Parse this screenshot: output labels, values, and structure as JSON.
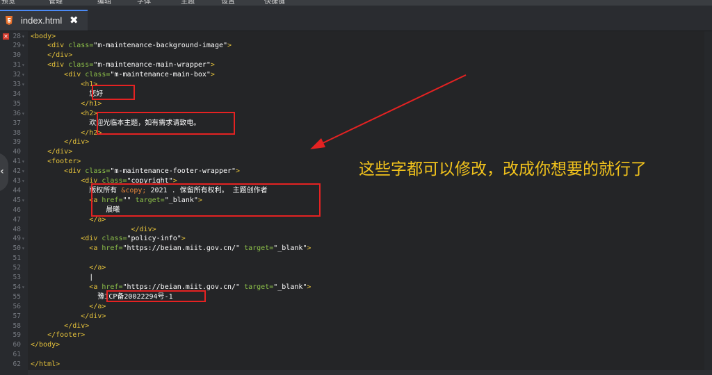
{
  "menu": [
    "预览",
    "管理",
    "编辑",
    "字体",
    "主题",
    "设置",
    "快捷键"
  ],
  "tab": {
    "filename": "index.html",
    "close_label": "✖"
  },
  "lines": [
    {
      "n": "28",
      "html": "<span class=\"tag\">&lt;body&gt;</span>"
    },
    {
      "n": "29",
      "html": "    <span class=\"tag\">&lt;div</span> <span class=\"attr\">class=</span><span class=\"str\">\"m-maintenance-background-image\"</span><span class=\"tag\">&gt;</span>"
    },
    {
      "n": "30",
      "html": "    <span class=\"tag\">&lt;/div&gt;</span>"
    },
    {
      "n": "31",
      "html": "    <span class=\"tag\">&lt;div</span> <span class=\"attr\">class=</span><span class=\"str\">\"m-maintenance-main-wrapper\"</span><span class=\"tag\">&gt;</span>"
    },
    {
      "n": "32",
      "html": "        <span class=\"tag\">&lt;div</span> <span class=\"attr\">class=</span><span class=\"str\">\"m-maintenance-main-box\"</span><span class=\"tag\">&gt;</span>"
    },
    {
      "n": "33",
      "html": "            <span class=\"tag\">&lt;h1&gt;</span>"
    },
    {
      "n": "34",
      "html": "              <span class=\"txt\">您好</span>"
    },
    {
      "n": "35",
      "html": "            <span class=\"tag\">&lt;/h1&gt;</span>"
    },
    {
      "n": "36",
      "html": "            <span class=\"tag\">&lt;h2&gt;</span>"
    },
    {
      "n": "37",
      "html": "              <span class=\"txt\">欢迎光临本主题，如有需求请致电。</span>"
    },
    {
      "n": "38",
      "html": "            <span class=\"tag\">&lt;/h2&gt;</span>"
    },
    {
      "n": "39",
      "html": "        <span class=\"tag\">&lt;/div&gt;</span>"
    },
    {
      "n": "40",
      "html": "    <span class=\"tag\">&lt;/div&gt;</span>"
    },
    {
      "n": "41",
      "html": "    <span class=\"tag\">&lt;footer&gt;</span>"
    },
    {
      "n": "42",
      "html": "        <span class=\"tag\">&lt;div</span> <span class=\"attr\">class=</span><span class=\"str\">\"m-maintenance-footer-wrapper\"</span><span class=\"tag\">&gt;</span>"
    },
    {
      "n": "43",
      "html": "            <span class=\"tag\">&lt;div</span> <span class=\"attr\">class=</span><span class=\"str\">\"copyright\"</span><span class=\"tag\">&gt;</span>"
    },
    {
      "n": "44",
      "html": "              <span class=\"txt\">版权所有 </span><span class=\"ent\">&amp;copy;</span><span class=\"txt\"> 2021 . 保留所有权利。 主题创作者</span>"
    },
    {
      "n": "45",
      "html": "              <span class=\"tag\">&lt;a</span> <span class=\"attr\">href=</span><span class=\"str\">\"\"</span> <span class=\"attr\">target=</span><span class=\"str\">\"_blank\"</span><span class=\"tag\">&gt;</span>"
    },
    {
      "n": "46",
      "html": "                  <span class=\"txt\">晨曦</span>"
    },
    {
      "n": "47",
      "html": "              <span class=\"tag\">&lt;/a&gt;</span>"
    },
    {
      "n": "48",
      "html": "                        <span class=\"tag\">&lt;/div&gt;</span>"
    },
    {
      "n": "49",
      "html": "            <span class=\"tag\">&lt;div</span> <span class=\"attr\">class=</span><span class=\"str\">\"policy-info\"</span><span class=\"tag\">&gt;</span>"
    },
    {
      "n": "50",
      "html": "              <span class=\"tag\">&lt;a</span> <span class=\"attr\">href=</span><span class=\"str\">\"https://beian.miit.gov.cn/\"</span> <span class=\"attr\">target=</span><span class=\"str\">\"_blank\"</span><span class=\"tag\">&gt;</span>"
    },
    {
      "n": "51",
      "html": ""
    },
    {
      "n": "52",
      "html": "              <span class=\"tag\">&lt;/a&gt;</span>"
    },
    {
      "n": "53",
      "html": "              <span class=\"txt\">|</span>"
    },
    {
      "n": "54",
      "html": "              <span class=\"tag\">&lt;a</span> <span class=\"attr\">href=</span><span class=\"str\">\"https://beian.miit.gov.cn/\"</span> <span class=\"attr\">target=</span><span class=\"str\">\"_blank\"</span><span class=\"tag\">&gt;</span>"
    },
    {
      "n": "55",
      "html": "                <span class=\"txt\">豫ICP备20022294号-1</span>"
    },
    {
      "n": "56",
      "html": "              <span class=\"tag\">&lt;/a&gt;</span>"
    },
    {
      "n": "57",
      "html": "            <span class=\"tag\">&lt;/div&gt;</span>"
    },
    {
      "n": "58",
      "html": "        <span class=\"tag\">&lt;/div&gt;</span>"
    },
    {
      "n": "59",
      "html": "    <span class=\"tag\">&lt;/footer&gt;</span>"
    },
    {
      "n": "60",
      "html": "<span class=\"tag\">&lt;/body&gt;</span>"
    },
    {
      "n": "61",
      "html": ""
    },
    {
      "n": "62",
      "html": "<span class=\"tag\">&lt;/html&gt;</span>"
    }
  ],
  "annotation": "这些字都可以修改，改成你想要的就行了",
  "handle_label": "‹",
  "colors": {
    "tag": "#e6c33b",
    "attr": "#8dc149",
    "entity": "#e9863b",
    "box": "#e52222",
    "arrow": "#e52222",
    "annotation": "#f2c31c"
  }
}
